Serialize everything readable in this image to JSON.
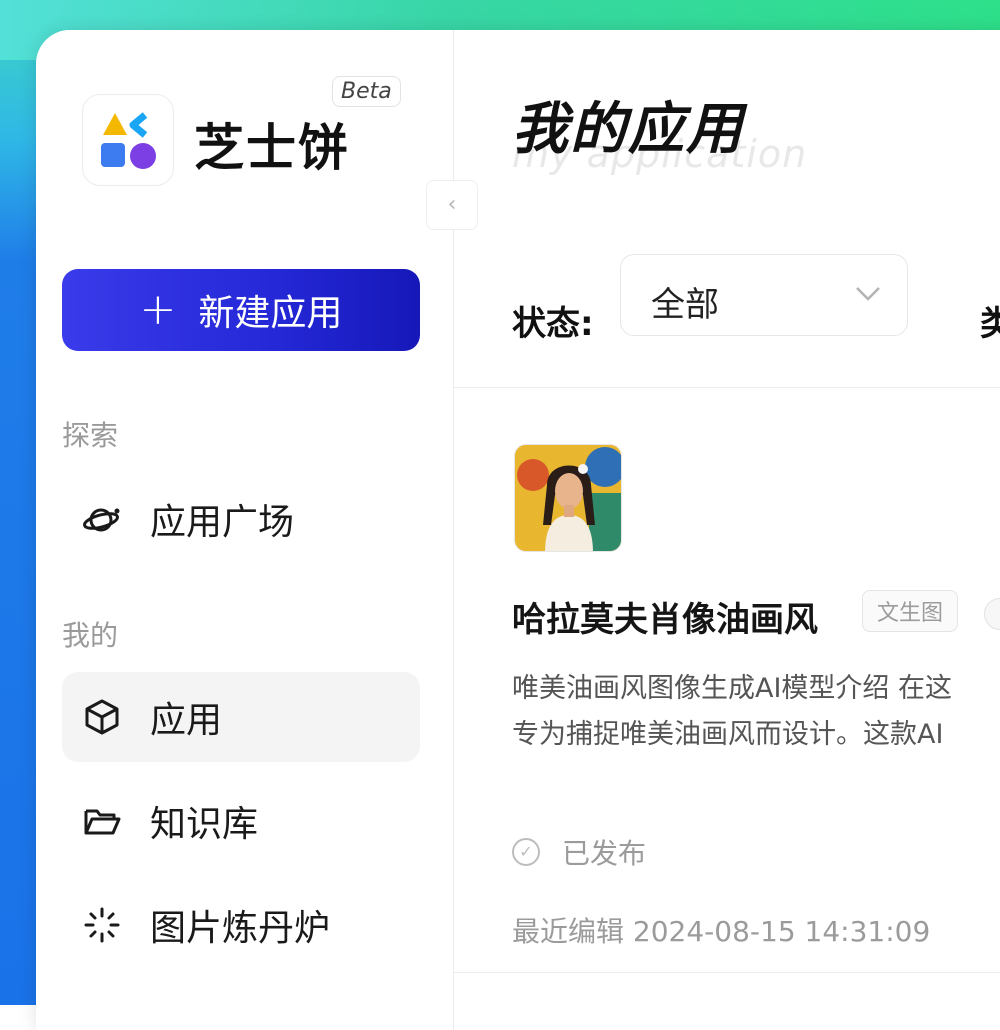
{
  "brand": {
    "name": "芝士饼",
    "badge": "Beta"
  },
  "sidebar": {
    "new_app_label": "新建应用",
    "sections": [
      {
        "label": "探索",
        "items": [
          {
            "label": "应用广场",
            "icon": "planet-icon"
          }
        ]
      },
      {
        "label": "我的",
        "items": [
          {
            "label": "应用",
            "icon": "cube-icon",
            "active": true
          },
          {
            "label": "知识库",
            "icon": "folder-icon"
          },
          {
            "label": "图片炼丹炉",
            "icon": "sparkle-loader-icon"
          }
        ]
      }
    ]
  },
  "main": {
    "title": "我的应用",
    "subtitle": "my application",
    "filters": {
      "status_label": "状态:",
      "status_value": "全部",
      "second_label": "类"
    },
    "apps": [
      {
        "name": "哈拉莫夫肖像油画风",
        "tag": "文生图",
        "description_lines": [
          "唯美油画风图像生成AI模型介绍 在这",
          "专为捕捉唯美油画风而设计。这款AI"
        ],
        "status": "已发布",
        "last_edited_label": "最近编辑",
        "last_edited_time": "2024-08-15 14:31:09"
      }
    ]
  },
  "colors": {
    "primary_button": "#2428d6",
    "text_primary": "#111111",
    "text_muted": "#9b9b9b"
  }
}
